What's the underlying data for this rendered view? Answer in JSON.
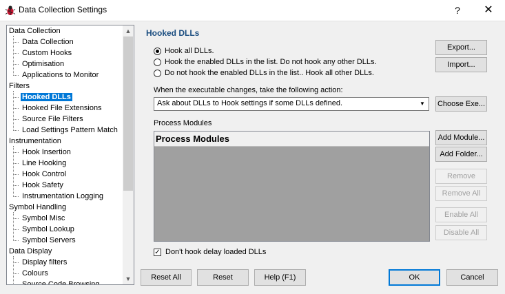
{
  "window": {
    "title": "Data Collection Settings",
    "help_glyph": "?",
    "close_glyph": "✕"
  },
  "tree": {
    "items": [
      {
        "label": "Data Collection",
        "level": 0
      },
      {
        "label": "Data Collection",
        "level": 1
      },
      {
        "label": "Custom Hooks",
        "level": 1
      },
      {
        "label": "Optimisation",
        "level": 1
      },
      {
        "label": "Applications to Monitor",
        "level": 1
      },
      {
        "label": "Filters",
        "level": 0
      },
      {
        "label": "Hooked DLLs",
        "level": 1,
        "selected": true
      },
      {
        "label": "Hooked File Extensions",
        "level": 1
      },
      {
        "label": "Source File Filters",
        "level": 1
      },
      {
        "label": "Load Settings Pattern Match",
        "level": 1
      },
      {
        "label": "Instrumentation",
        "level": 0
      },
      {
        "label": "Hook Insertion",
        "level": 1
      },
      {
        "label": "Line Hooking",
        "level": 1
      },
      {
        "label": "Hook Control",
        "level": 1
      },
      {
        "label": "Hook Safety",
        "level": 1
      },
      {
        "label": "Instrumentation Logging",
        "level": 1
      },
      {
        "label": "Symbol Handling",
        "level": 0
      },
      {
        "label": "Symbol Misc",
        "level": 1
      },
      {
        "label": "Symbol Lookup",
        "level": 1
      },
      {
        "label": "Symbol Servers",
        "level": 1
      },
      {
        "label": "Data Display",
        "level": 0
      },
      {
        "label": "Display filters",
        "level": 1
      },
      {
        "label": "Colours",
        "level": 1
      },
      {
        "label": "Source Code Browsing",
        "level": 1
      }
    ]
  },
  "page": {
    "section_title": "Hooked DLLs",
    "radios": [
      {
        "label": "Hook all DLLs.",
        "checked": true
      },
      {
        "label": "Hook the enabled DLLs in the list. Do not hook any other DLLs.",
        "checked": false
      },
      {
        "label": "Do not hook the enabled DLLs in the list.. Hook all other DLLs.",
        "checked": false
      }
    ],
    "exe_change_label": "When the executable changes, take the following action:",
    "exe_change_value": "Ask about DLLs to Hook settings if some DLLs defined.",
    "process_modules_label": "Process Modules",
    "process_modules_header": "Process Modules",
    "delay_loaded_label": "Don't hook delay loaded DLLs",
    "delay_loaded_checked": true
  },
  "buttons": {
    "export": "Export...",
    "import": "Import...",
    "choose_exe": "Choose Exe...",
    "add_module": "Add Module...",
    "add_folder": "Add Folder...",
    "remove": "Remove",
    "remove_all": "Remove All",
    "enable_all": "Enable All",
    "disable_all": "Disable All",
    "reset_all": "Reset All",
    "reset": "Reset",
    "help": "Help (F1)",
    "ok": "OK",
    "cancel": "Cancel"
  },
  "icons": {
    "app_icon": "bug-icon",
    "dropdown": "chevron-down-icon",
    "scroll_up": "arrow-up-icon",
    "scroll_down": "arrow-down-icon",
    "check": "✓"
  },
  "colors": {
    "section_title": "#1a4d80",
    "selection": "#0078d7",
    "list_background": "#a0a0a0"
  }
}
